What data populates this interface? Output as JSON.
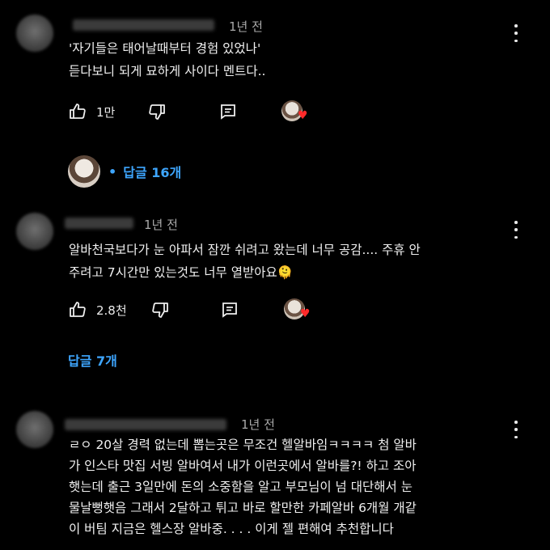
{
  "comments": [
    {
      "time": "1년 전",
      "lines": [
        "'자기들은 태어날때부터 경험 있었나'",
        "듣다보니 되게 묘하게 사이다 멘트다.."
      ],
      "likes": "1만",
      "replies": "답글 16개"
    },
    {
      "time": "1년 전",
      "lines": [
        "알바천국보다가 눈 아파서 잠깐 쉬려고 왔는데 너무 공감.... 주휴 안",
        "주려고 7시간만 있는것도 너무 열받아요🫠"
      ],
      "likes": "2.8천",
      "replies": "답글 7개"
    },
    {
      "time": "1년 전",
      "lines": [
        "ㄹㅇ 20살 경력 없는데 뽑는곳은 무조건 헬알바임ㅋㅋㅋㅋ 첨 알바",
        "가 인스타 맛집 서빙 알바여서 내가 이런곳에서 알바를?! 하고 조아",
        "햇는데 출근 3일만에 돈의 소중함을 알고 부모님이 넘 대단해서 눈",
        "물날뻥햇음 그래서 2달하고 튀고 바로 할만한 카페알바 6개월 개같",
        "이 버팀 지금은 헬스장 알바중. . . . 이게 젤 편해여 추천합니다"
      ]
    }
  ],
  "icons": {
    "like": "thumb-up-icon",
    "dislike": "thumb-down-icon",
    "reply": "comment-icon",
    "more": "more-vertical-icon",
    "heart": "heart-icon"
  },
  "colors": {
    "link": "#3ea6ff",
    "heart": "#ff2a2a",
    "background": "#000000"
  }
}
